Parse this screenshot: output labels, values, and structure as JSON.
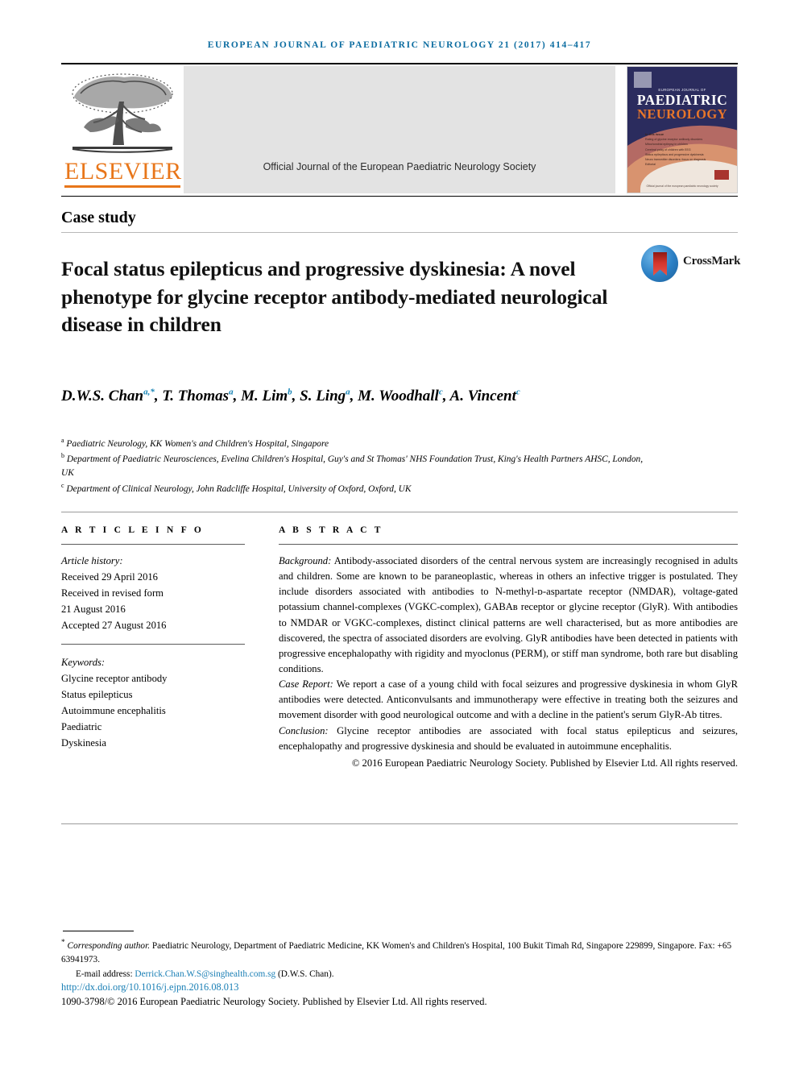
{
  "running_head": "EUROPEAN JOURNAL OF PAEDIATRIC NEUROLOGY 21 (2017) 414–417",
  "masthead": {
    "publisher_name": "ELSEVIER",
    "society_line": "Official Journal of the European Paediatric Neurology Society",
    "cover": {
      "tagline": "EUROPEAN JOURNAL OF",
      "line1": "PAEDIATRIC",
      "line2": "NEUROLOGY",
      "contents_title": "In this issue",
      "contents": [
        "Rating of glycine receptor antibody disorders",
        "Mitochondrial epilepsy in children",
        "Cerebral palsy of children with EEG",
        "Status epilepticus and progressive dyskinesia",
        "Neuro transmitter disorders: focus on diagnosis",
        "Editorial"
      ],
      "footer": "Official journal of the european paediatric neurology society",
      "logo_alt": "elsevier-colophon"
    }
  },
  "article_type": "Case study",
  "title": "Focal status epilepticus and progressive dyskinesia: A novel phenotype for glycine receptor antibody-mediated neurological disease in children",
  "crossmark": {
    "label": "CrossMark"
  },
  "authors": [
    {
      "name": "D.W.S. Chan",
      "sup": "a,*"
    },
    {
      "name": "T. Thomas",
      "sup": "a"
    },
    {
      "name": "M. Lim",
      "sup": "b"
    },
    {
      "name": "S. Ling",
      "sup": "a"
    },
    {
      "name": "M. Woodhall",
      "sup": "c"
    },
    {
      "name": "A. Vincent",
      "sup": "c"
    }
  ],
  "affiliations": [
    {
      "mark": "a",
      "text": "Paediatric Neurology, KK Women's and Children's Hospital, Singapore"
    },
    {
      "mark": "b",
      "text": "Department of Paediatric Neurosciences, Evelina Children's Hospital, Guy's and St Thomas' NHS Foundation Trust, King's Health Partners AHSC, London, UK"
    },
    {
      "mark": "c",
      "text": "Department of Clinical Neurology, John Radcliffe Hospital, University of Oxford, Oxford, UK"
    }
  ],
  "article_info": {
    "heading": "A R T I C L E   I N F O",
    "history_label": "Article history:",
    "history": [
      "Received 29 April 2016",
      "Received in revised form",
      "21 August 2016",
      "Accepted 27 August 2016"
    ],
    "keywords_label": "Keywords:",
    "keywords": [
      "Glycine receptor antibody",
      "Status epilepticus",
      "Autoimmune encephalitis",
      "Paediatric",
      "Dyskinesia"
    ]
  },
  "abstract": {
    "heading": "A B S T R A C T",
    "background_label": "Background:",
    "background_text": " Antibody-associated disorders of the central nervous system are increasingly recognised in adults and children. Some are known to be paraneoplastic, whereas in others an infective trigger is postulated. They include disorders associated with antibodies to N-methyl-ᴅ-aspartate receptor (NMDAR), voltage-gated potassium channel-complexes (VGKC-complex), GABAʙ receptor or glycine receptor (GlyR). With antibodies to NMDAR or VGKC-complexes, distinct clinical patterns are well characterised, but as more antibodies are discovered, the spectra of associated disorders are evolving. GlyR antibodies have been detected in patients with progressive encephalopathy with rigidity and myoclonus (PERM), or stiff man syndrome, both rare but disabling conditions.",
    "case_label": "Case Report:",
    "case_text": " We report a case of a young child with focal seizures and progressive dyskinesia in whom GlyR antibodies were detected. Anticonvulsants and immunotherapy were effective in treating both the seizures and movement disorder with good neurological outcome and with a decline in the patient's serum GlyR-Ab titres.",
    "conclusion_label": "Conclusion:",
    "conclusion_text": " Glycine receptor antibodies are associated with focal status epilepticus and seizures, encephalopathy and progressive dyskinesia and should be evaluated in autoimmune encephalitis.",
    "copyright": "© 2016 European Paediatric Neurology Society. Published by Elsevier Ltd. All rights reserved."
  },
  "footer": {
    "corresponding_mark": "*",
    "corresponding_label": "Corresponding author.",
    "corresponding_text": " Paediatric Neurology, Department of Paediatric Medicine, KK Women's and Children's Hospital, 100 Bukit Timah Rd, Singapore 229899, Singapore. Fax: +65 63941973.",
    "email_label": "E-mail address:",
    "email": "Derrick.Chan.W.S@singhealth.com.sg",
    "email_owner": "(D.W.S. Chan).",
    "doi": "http://dx.doi.org/10.1016/j.ejpn.2016.08.013",
    "issn_line": "1090-3798/© 2016 European Paediatric Neurology Society. Published by Elsevier Ltd. All rights reserved."
  },
  "colors": {
    "running_head": "#0b6ca0",
    "elsevier_orange": "#e8761a",
    "link_blue": "#1a7fb5",
    "cover_navy": "#2b2c5e",
    "band_gray": "#e3e3e3"
  }
}
